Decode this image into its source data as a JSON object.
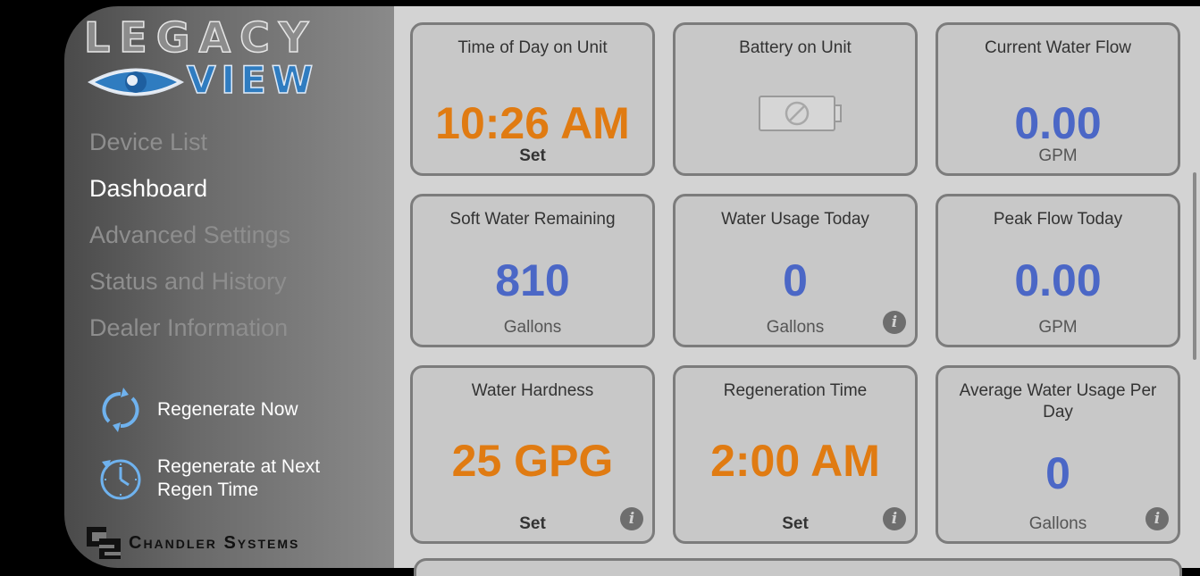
{
  "logo": {
    "top": "LEGACY",
    "bottom": "VIEW"
  },
  "nav": [
    {
      "label": "Device List",
      "active": false
    },
    {
      "label": "Dashboard",
      "active": true
    },
    {
      "label": "Advanced Settings",
      "active": false
    },
    {
      "label": "Status and History",
      "active": false
    },
    {
      "label": "Dealer Information",
      "active": false
    }
  ],
  "actions": {
    "regen_now": "Regenerate Now",
    "regen_next": "Regenerate at Next Regen Time"
  },
  "brand": "Chandler Systems",
  "cards": {
    "time_of_day": {
      "title": "Time of Day on Unit",
      "value": "10:26 AM",
      "unit": "Set"
    },
    "battery": {
      "title": "Battery on Unit"
    },
    "current_flow": {
      "title": "Current Water Flow",
      "value": "0.00",
      "unit": "GPM"
    },
    "soft_water": {
      "title": "Soft Water Remaining",
      "value": "810",
      "unit": "Gallons"
    },
    "usage_today": {
      "title": "Water Usage Today",
      "value": "0",
      "unit": "Gallons"
    },
    "peak_flow": {
      "title": "Peak Flow Today",
      "value": "0.00",
      "unit": "GPM"
    },
    "hardness": {
      "title": "Water Hardness",
      "value": "25 GPG",
      "unit": "Set"
    },
    "regen_time": {
      "title": "Regeneration Time",
      "value": "2:00 AM",
      "unit": "Set"
    },
    "avg_usage": {
      "title": "Average Water Usage Per Day",
      "value": "0",
      "unit": "Gallons"
    }
  },
  "info_symbol": "i",
  "colors": {
    "orange": "#e07b12",
    "blue": "#4b67c6"
  }
}
